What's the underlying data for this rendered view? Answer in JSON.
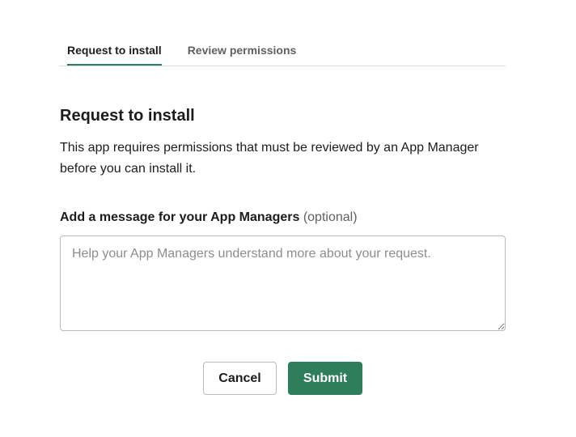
{
  "tabs": [
    {
      "label": "Request to install",
      "active": true
    },
    {
      "label": "Review permissions",
      "active": false
    }
  ],
  "section": {
    "title": "Request to install",
    "description": "This app requires permissions that must be reviewed by an App Manager before you can install it."
  },
  "message_field": {
    "label": "Add a message for your App Managers",
    "optional_label": "(optional)",
    "value": "",
    "placeholder": "Help your App Managers understand more about your request."
  },
  "buttons": {
    "cancel_label": "Cancel",
    "submit_label": "Submit"
  },
  "colors": {
    "accent": "#2e7d5b",
    "text_primary": "#1d1c1d",
    "text_secondary": "#616061",
    "border": "#bbbbbb"
  }
}
